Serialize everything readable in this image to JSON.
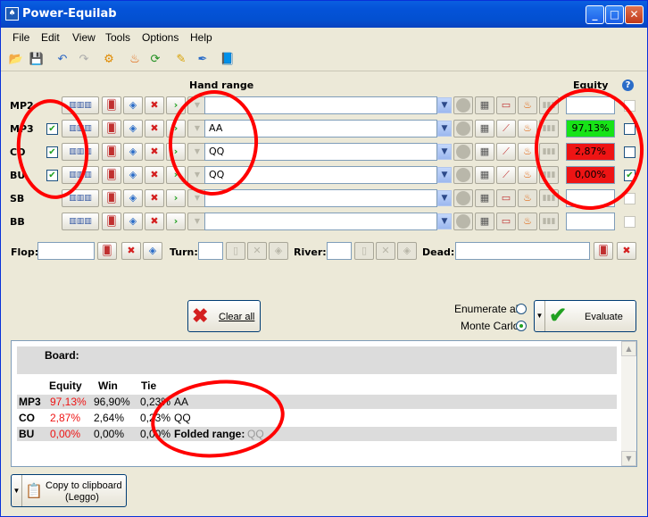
{
  "window": {
    "title": "Power-Equilab"
  },
  "menu": [
    "File",
    "Edit",
    "View",
    "Tools",
    "Options",
    "Help"
  ],
  "headers": {
    "hand_range": "Hand range",
    "equity": "Equity",
    "help": "?"
  },
  "players": [
    {
      "pos": "MP2",
      "checked": false,
      "range": "",
      "equity": "",
      "equity_color": "none",
      "right_checked": false,
      "active": false
    },
    {
      "pos": "MP3",
      "checked": true,
      "range": "AA",
      "equity": "97,13%",
      "equity_color": "green",
      "right_checked": false,
      "active": true
    },
    {
      "pos": "CO",
      "checked": true,
      "range": "QQ",
      "equity": "2,87%",
      "equity_color": "red",
      "right_checked": false,
      "active": true
    },
    {
      "pos": "BU",
      "checked": true,
      "range": "QQ",
      "equity": "0,00%",
      "equity_color": "red",
      "right_checked": true,
      "active": true
    },
    {
      "pos": "SB",
      "checked": false,
      "range": "",
      "equity": "",
      "equity_color": "none",
      "right_checked": false,
      "active": false
    },
    {
      "pos": "BB",
      "checked": false,
      "range": "",
      "equity": "",
      "equity_color": "none",
      "right_checked": false,
      "active": false
    }
  ],
  "board": {
    "flop": "Flop:",
    "turn": "Turn:",
    "river": "River:",
    "dead": "Dead:"
  },
  "buttons": {
    "clear_all": "Clear all",
    "evaluate": "Evaluate",
    "copy_line1": "Copy to clipboard",
    "copy_line2": "(Leggo)"
  },
  "mode": {
    "enumerate": "Enumerate all",
    "monte_carlo": "Monte Carlo",
    "selected": "Monte Carlo"
  },
  "results": {
    "board_label": "Board:",
    "cols": [
      "Equity",
      "Win",
      "Tie"
    ],
    "rows": [
      {
        "pos": "MP3",
        "equity": "97,13%",
        "win": "96,90%",
        "tie": "0,23%",
        "hand": "AA",
        "folded": ""
      },
      {
        "pos": "CO",
        "equity": "2,87%",
        "win": "2,64%",
        "tie": "0,23%",
        "hand": "QQ",
        "folded": ""
      },
      {
        "pos": "BU",
        "equity": "0,00%",
        "win": "0,00%",
        "tie": "0,00%",
        "hand": "",
        "folded": "Folded range:",
        "folded_value": "QQ"
      }
    ]
  },
  "colors": {
    "equity_green": "#17e317",
    "equity_red": "#ee1414",
    "annotation": "#ff0000"
  }
}
